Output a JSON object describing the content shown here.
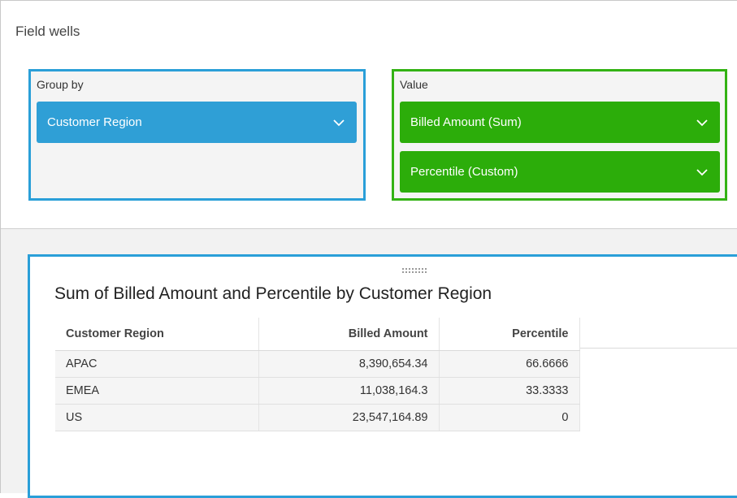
{
  "field_wells": {
    "title": "Field wells",
    "group_by": {
      "label": "Group by",
      "items": [
        "Customer Region"
      ],
      "color": "#2f9fd6"
    },
    "value": {
      "label": "Value",
      "items": [
        "Billed Amount (Sum)",
        "Percentile (Custom)"
      ],
      "color": "#2cad0a"
    }
  },
  "visual": {
    "title": "Sum of Billed Amount and Percentile by Customer Region",
    "columns": [
      "Customer Region",
      "Billed Amount",
      "Percentile"
    ],
    "rows": [
      [
        "APAC",
        "8,390,654.34",
        "66.6666"
      ],
      [
        "EMEA",
        "11,038,164.3",
        "33.3333"
      ],
      [
        "US",
        "23,547,164.89",
        "0"
      ]
    ],
    "accent": "#2a9fd8"
  },
  "icons": {
    "dropdown": "chevron-down-icon",
    "drag": "drag-handle-icon"
  }
}
